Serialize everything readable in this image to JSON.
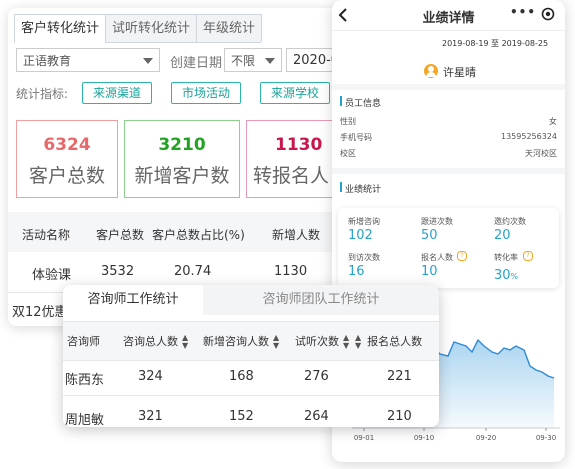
{
  "crm": {
    "tabs": [
      "客户转化统计",
      "试听转化统计",
      "年级统计"
    ],
    "org_select": "正语教育",
    "date_label": "创建日期",
    "date_select": "不限",
    "date_value": "2020-0",
    "filter_label": "统计指标:",
    "chips": [
      "来源渠道",
      "市场活动",
      "来源学校"
    ],
    "cards": [
      {
        "value": "6324",
        "label": "客户总数",
        "color": "#e8696b"
      },
      {
        "value": "3210",
        "label": "新增客户数",
        "color": "#22a322"
      },
      {
        "value": "1130",
        "label": "转报名人",
        "color": "#c8174e"
      }
    ],
    "table_headers": [
      "活动名称",
      "客户总数",
      "客户总数占比(%)",
      "新增人数"
    ],
    "table_row": [
      "体验课",
      "3532",
      "20.74",
      "1130"
    ],
    "footer_text": "双12优惠"
  },
  "mobile": {
    "back_icon": "chevron-left-icon",
    "title": "业绩详情",
    "more_icon": "more-icon",
    "target_icon": "record-icon",
    "date_from": "2019-08-19",
    "date_sep": "至",
    "date_to": "2019-08-25",
    "user_name": "许星晴",
    "section_info": "员工信息",
    "info_rows": [
      {
        "label": "性别",
        "value": "女"
      },
      {
        "label": "手机号码",
        "value": "13595256324"
      },
      {
        "label": "校区",
        "value": "天河校区"
      }
    ],
    "section_perf": "业绩统计",
    "stats": [
      {
        "label": "新增咨询",
        "value": "102"
      },
      {
        "label": "跟进次数",
        "value": "50"
      },
      {
        "label": "邀约次数",
        "value": "20"
      },
      {
        "label": "到访次数",
        "value": "16"
      },
      {
        "label": "报名人数",
        "value": "10"
      },
      {
        "label": "转化率",
        "value": "30",
        "unit": "%"
      }
    ],
    "accent": "#26a3c9",
    "chart_data": {
      "type": "area",
      "x_ticks": [
        "09-01",
        "09-10",
        "09-20",
        "09-30"
      ]
    }
  },
  "consult": {
    "tabs": [
      "咨询师工作统计",
      "咨询师团队工作统计"
    ],
    "headers": [
      "咨询师",
      "咨询总人数",
      "新增咨询人数",
      "试听次数",
      "报名总人数"
    ],
    "rows": [
      [
        "陈西东",
        "324",
        "168",
        "276",
        "221"
      ],
      [
        "周旭敏",
        "321",
        "152",
        "264",
        "210"
      ]
    ]
  }
}
